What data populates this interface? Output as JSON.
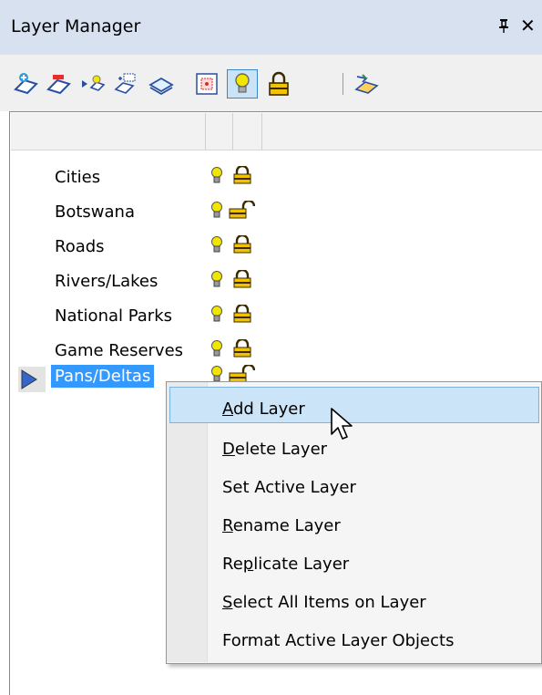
{
  "window": {
    "title": "Layer Manager",
    "pin_glyph": "ᵖ",
    "close_glyph": "✕"
  },
  "toolbar": {
    "icons": [
      "add-layer-icon",
      "delete-layer-icon",
      "set-active-layer-icon",
      "select-items-icon",
      "layers-icon",
      "format-icon",
      "visibility-bulb-icon",
      "lock-icon",
      "properties-icon"
    ]
  },
  "layers": [
    {
      "name": "Cities",
      "visible": true,
      "locked": true
    },
    {
      "name": "Botswana",
      "visible": true,
      "locked": false
    },
    {
      "name": "Roads",
      "visible": true,
      "locked": true
    },
    {
      "name": "Rivers/Lakes",
      "visible": true,
      "locked": true
    },
    {
      "name": "National Parks",
      "visible": true,
      "locked": true
    },
    {
      "name": "Game Reserves",
      "visible": true,
      "locked": true
    },
    {
      "name": "Pans/Deltas",
      "visible": true,
      "locked": false,
      "selected": true
    }
  ],
  "context_menu": {
    "items": [
      {
        "label": "Add Layer",
        "mnemonic": "A",
        "hover": true
      },
      {
        "label": "Delete Layer",
        "mnemonic": "D"
      },
      {
        "label": "Set Active Layer",
        "mnemonic": ""
      },
      {
        "label": "Rename Layer",
        "mnemonic": "R"
      },
      {
        "label": "Replicate Layer",
        "mnemonic": "p"
      },
      {
        "label": "Select All Items on Layer",
        "mnemonic": "S"
      },
      {
        "label": "Format Active Layer Objects",
        "mnemonic": ""
      }
    ]
  },
  "colors": {
    "selection": "#3399ff",
    "title_bar": "#d7e1ef",
    "menu_hover": "#cce4f7",
    "bulb": "#f2e600",
    "lock": "#f2c200"
  }
}
